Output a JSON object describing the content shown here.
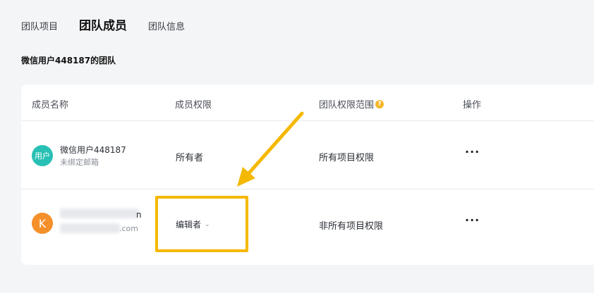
{
  "tabs": [
    {
      "label": "团队项目",
      "active": false
    },
    {
      "label": "团队成员",
      "active": true
    },
    {
      "label": "团队信息",
      "active": false
    }
  ],
  "team_title": "微信用户448187的团队",
  "table": {
    "headers": [
      "成员名称",
      "成员权限",
      "团队权限范围",
      "操作"
    ],
    "help_icon": "?",
    "rows": [
      {
        "avatar_text": "用户",
        "name": "微信用户448187",
        "sub": "未绑定邮箱",
        "role": "所有者",
        "scope": "所有项目权限",
        "action": "···"
      },
      {
        "avatar_text": "K",
        "name_visible_tail": "n",
        "sub_visible_tail": ".com",
        "role": "编辑者",
        "scope": "非所有项目权限",
        "action": "···"
      }
    ]
  },
  "colors": {
    "highlight": "#f5b800",
    "avatar_teal": "#28c0b4",
    "avatar_orange": "#f58f2a",
    "help_icon": "#f5b72a"
  }
}
